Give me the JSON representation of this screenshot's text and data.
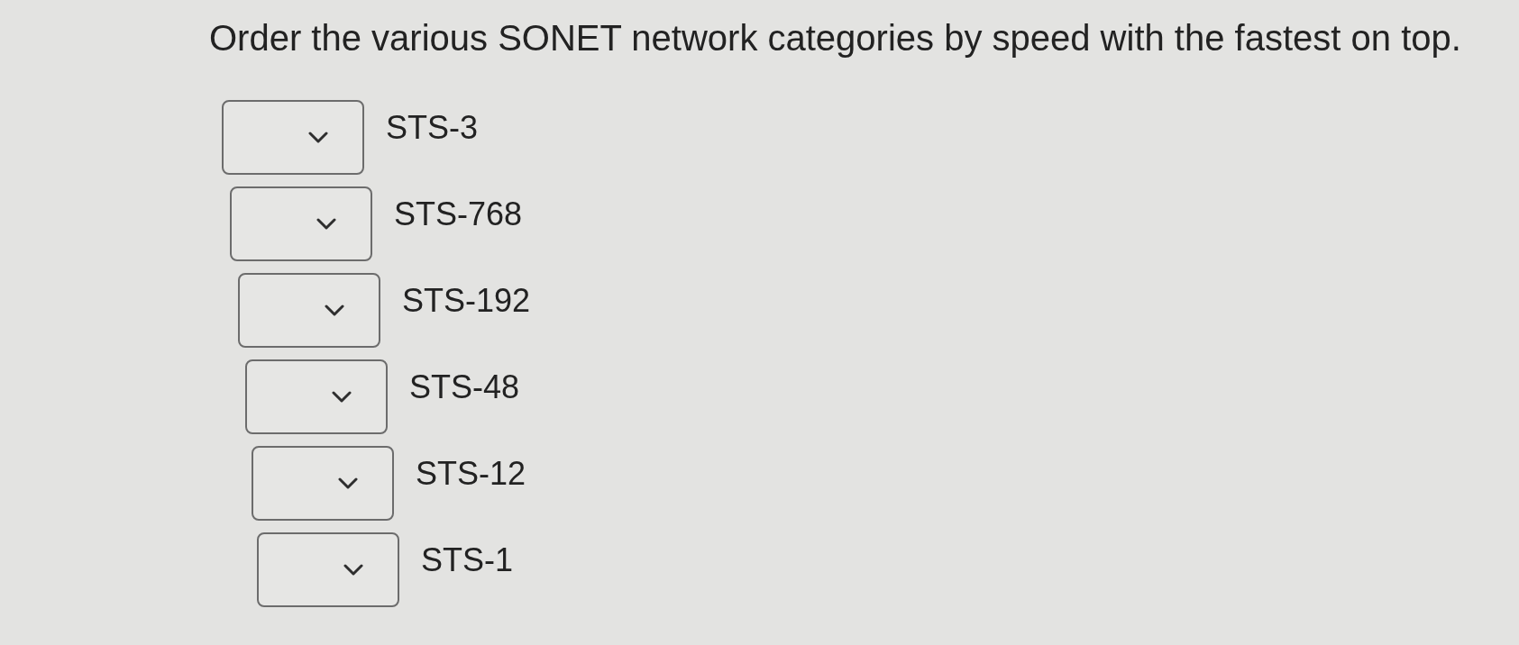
{
  "question": "Order the various SONET network categories by speed with the fastest on top.",
  "items": [
    {
      "label": "STS-3"
    },
    {
      "label": "STS-768"
    },
    {
      "label": "STS-192"
    },
    {
      "label": "STS-48"
    },
    {
      "label": "STS-12"
    },
    {
      "label": "STS-1"
    }
  ]
}
